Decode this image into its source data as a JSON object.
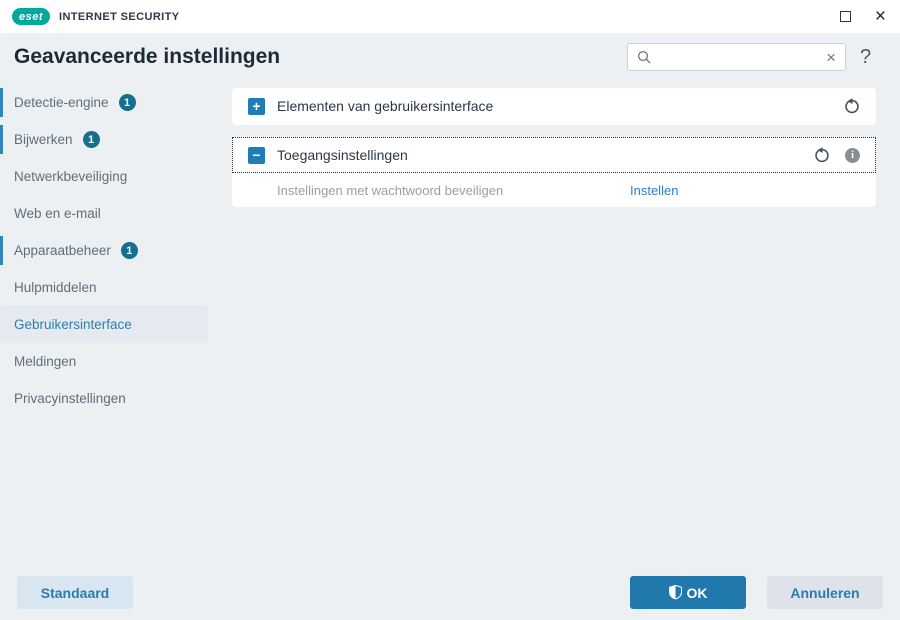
{
  "titlebar": {
    "logo_text": "eset",
    "product_name": "INTERNET SECURITY"
  },
  "header": {
    "title": "Geavanceerde instellingen",
    "search_value": "",
    "help_glyph": "?"
  },
  "icons": {
    "close_glyph": "×",
    "search_clear_glyph": "×",
    "info_glyph": "i"
  },
  "sidebar": {
    "items": [
      {
        "label": "Detectie-engine",
        "badge": "1"
      },
      {
        "label": "Bijwerken",
        "badge": "1"
      },
      {
        "label": "Netwerkbeveiliging"
      },
      {
        "label": "Web en e-mail"
      },
      {
        "label": "Apparaatbeheer",
        "badge": "1"
      },
      {
        "label": "Hulpmiddelen"
      },
      {
        "label": "Gebruikersinterface",
        "selected": true
      },
      {
        "label": "Meldingen"
      },
      {
        "label": "Privacyinstellingen"
      }
    ]
  },
  "main": {
    "sections": [
      {
        "title": "Elementen van gebruikersinterface",
        "state": "collapsed",
        "expand_glyph": "+"
      },
      {
        "title": "Toegangsinstellingen",
        "state": "expanded",
        "expand_glyph": "−",
        "row": {
          "label": "Instellingen met wachtwoord beveiligen",
          "action_label": "Instellen"
        }
      }
    ]
  },
  "footer": {
    "default_button": "Standaard",
    "ok_button": "OK",
    "cancel_button": "Annuleren"
  },
  "colors": {
    "brand_teal": "#00a99d",
    "accent_blue": "#1d7db4",
    "badge_teal": "#166f8e",
    "link_blue": "#2a7dd2",
    "ok_button_bg": "#2178ad",
    "selected_item_text": "#2d7fa9",
    "background": "#edf0f3"
  }
}
